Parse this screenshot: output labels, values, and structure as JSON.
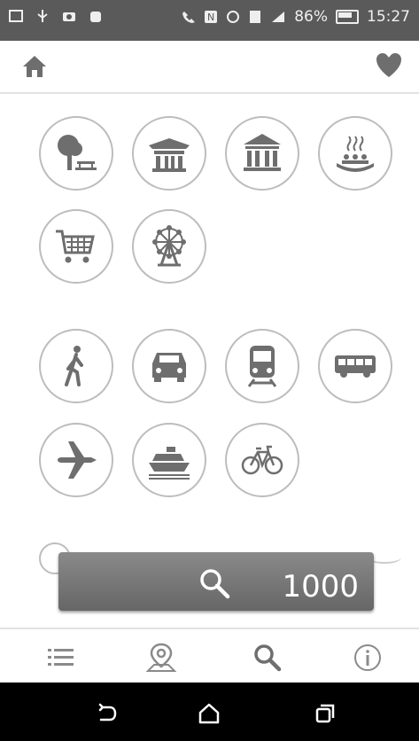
{
  "status": {
    "battery": "86%",
    "time": "15:27"
  },
  "search": {
    "radius": "1000"
  },
  "colors": {
    "statusbar": "#5a5a5a",
    "icon": "#6e6e6e",
    "searchbar": "#777777",
    "sysnav": "#000000"
  },
  "icons": {
    "top": [
      "home-icon",
      "heart-icon"
    ],
    "categories": [
      "park-icon",
      "temple-icon",
      "museum-icon",
      "hot-spring-icon",
      "shopping-cart-icon",
      "ferris-wheel-icon"
    ],
    "transport": [
      "walk-icon",
      "car-icon",
      "train-icon",
      "bus-icon",
      "airplane-icon",
      "ship-icon",
      "bicycle-icon"
    ],
    "bottom_nav": [
      "list-icon",
      "map-pin-icon",
      "search-icon",
      "info-icon"
    ],
    "system": [
      "back-icon",
      "home-icon",
      "recents-icon"
    ]
  }
}
